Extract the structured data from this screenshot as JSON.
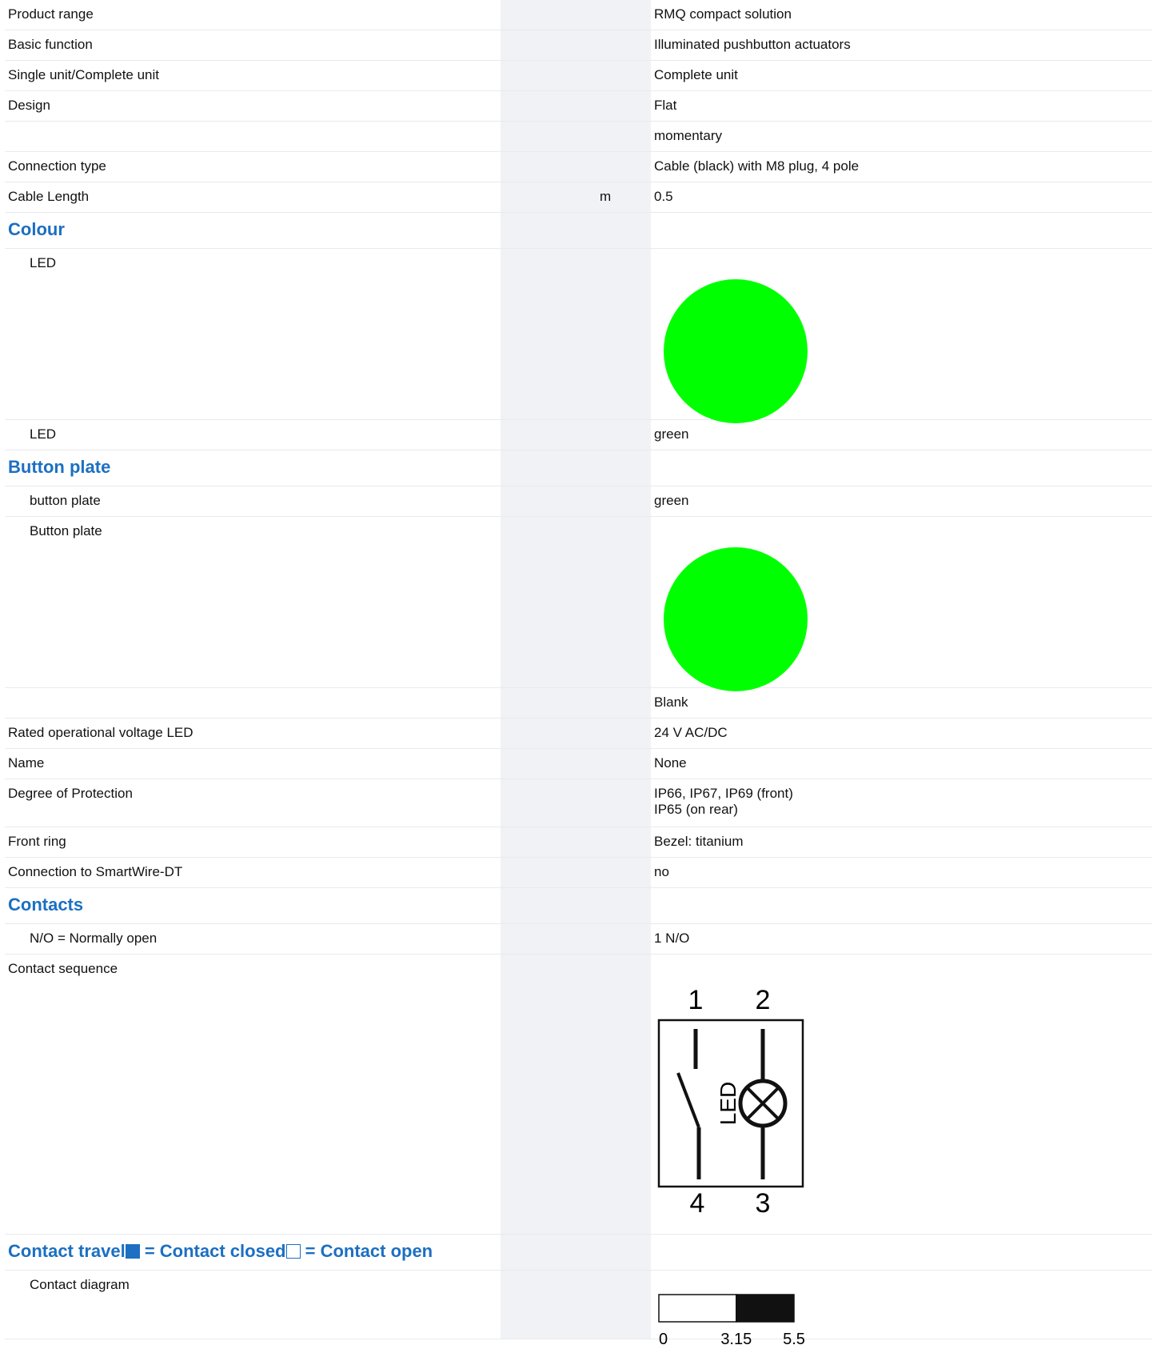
{
  "rows": {
    "product_range": {
      "label": "Product range",
      "value": "RMQ compact solution"
    },
    "basic_function": {
      "label": "Basic function",
      "value": "Illuminated pushbutton actuators"
    },
    "single_complete": {
      "label": "Single unit/Complete unit",
      "value": "Complete unit"
    },
    "design": {
      "label": "Design",
      "value": "Flat"
    },
    "design_2": {
      "label": "",
      "value": "momentary"
    },
    "connection_type": {
      "label": "Connection type",
      "value": "Cable (black) with M8 plug, 4 pole"
    },
    "cable_length": {
      "label": "Cable Length",
      "unit": "m",
      "value": "0.5"
    }
  },
  "colour": {
    "heading": "Colour",
    "led_image_label": "LED",
    "led_image_color": "#00ff00",
    "led_label": "LED",
    "led_value": "green"
  },
  "button_plate": {
    "heading": "Button plate",
    "plate_label": "button plate",
    "plate_value": "green",
    "plate_image_label": "Button plate",
    "plate_image_color": "#00ff00",
    "blank_value": "Blank"
  },
  "rows2": {
    "rated_voltage": {
      "label": "Rated operational voltage LED",
      "value": "24 V AC/DC"
    },
    "name": {
      "label": "Name",
      "value": "None"
    },
    "protection": {
      "label": "Degree of Protection",
      "value": "IP66, IP67, IP69 (front)\nIP65 (on rear)"
    },
    "front_ring": {
      "label": "Front ring",
      "value": "Bezel: titanium"
    },
    "smartwire": {
      "label": "Connection to SmartWire-DT",
      "value": "no"
    }
  },
  "contacts": {
    "heading": "Contacts",
    "no_label": "N/O = Normally open",
    "no_value": "1 N/O",
    "sequence_label": "Contact sequence",
    "diagram": {
      "t1": "1",
      "t2": "2",
      "t3": "3",
      "t4": "4",
      "led": "LED"
    }
  },
  "travel": {
    "heading_a": "Contact travel",
    "heading_b": " = Contact closed",
    "heading_c": " = Contact open",
    "closed_color": "#1c6fc2",
    "diagram_label": "Contact diagram",
    "ticks": [
      "0",
      "3.15",
      "5.5"
    ],
    "open_from": 0,
    "closed_from": 3.15,
    "end": 5.5
  }
}
